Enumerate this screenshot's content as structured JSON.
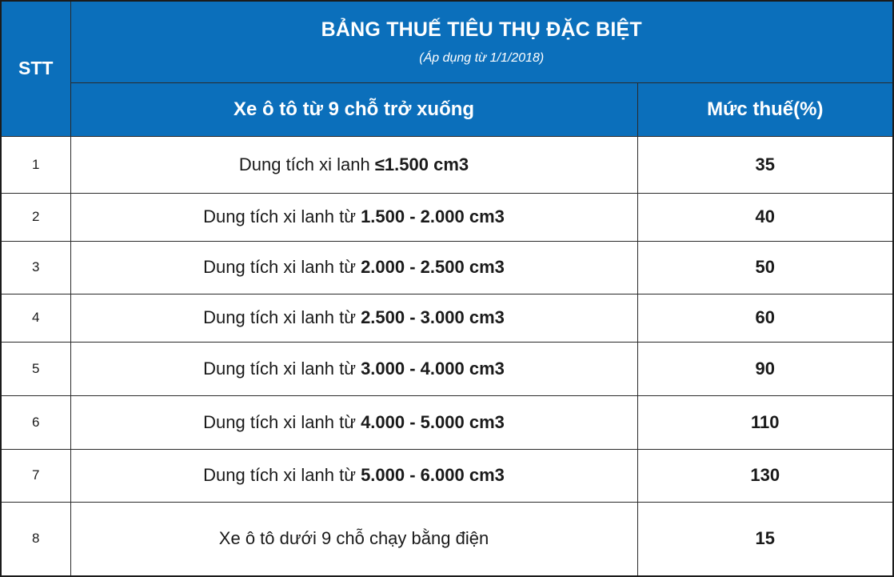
{
  "table": {
    "stt_header": "STT",
    "title": "BẢNG THUẾ TIÊU THỤ ĐẶC BIỆT",
    "subtitle": "(Áp dụng từ 1/1/2018)",
    "col_vehicle": "Xe ô tô từ 9 chỗ trở xuống",
    "col_rate": "Mức thuế(%)",
    "rows": [
      {
        "stt": "1",
        "desc_prefix": "Dung tích xi lanh ",
        "desc_bold": "≤1.500 cm3",
        "rate": "35"
      },
      {
        "stt": "2",
        "desc_prefix": "Dung tích xi lanh từ ",
        "desc_bold": "1.500 - 2.000 cm3",
        "rate": "40"
      },
      {
        "stt": "3",
        "desc_prefix": "Dung tích xi lanh từ ",
        "desc_bold": "2.000 - 2.500 cm3",
        "rate": "50"
      },
      {
        "stt": "4",
        "desc_prefix": "Dung tích xi lanh từ ",
        "desc_bold": "2.500 - 3.000 cm3",
        "rate": "60"
      },
      {
        "stt": "5",
        "desc_prefix": "Dung tích xi lanh từ ",
        "desc_bold": "3.000 - 4.000 cm3",
        "rate": "90"
      },
      {
        "stt": "6",
        "desc_prefix": "Dung tích xi lanh từ ",
        "desc_bold": "4.000 - 5.000 cm3",
        "rate": "110"
      },
      {
        "stt": "7",
        "desc_prefix": "Dung tích xi lanh từ ",
        "desc_bold": "5.000 - 6.000 cm3",
        "rate": "130"
      },
      {
        "stt": "8",
        "desc_prefix": "Xe ô tô dưới 9 chỗ chạy bằng điện",
        "desc_bold": "",
        "rate": "15"
      }
    ]
  },
  "colors": {
    "header_bg": "#0b6fbb",
    "header_text": "#ffffff",
    "border": "#2a2a2a"
  }
}
